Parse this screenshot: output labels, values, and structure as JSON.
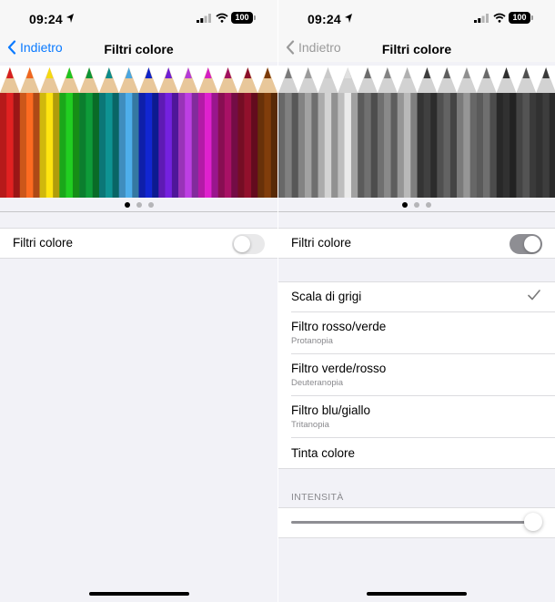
{
  "status": {
    "time": "09:24",
    "battery": "100"
  },
  "nav": {
    "back_label": "Indietro",
    "title": "Filtri colore"
  },
  "banner": {
    "color_pencils": [
      "#d61f1f",
      "#f0661f",
      "#f5d90f",
      "#1fc41f",
      "#0d9436",
      "#0d8c8c",
      "#4aa6e0",
      "#1024c8",
      "#6e1fd4",
      "#b43cd8",
      "#d41fc4",
      "#a01060",
      "#8a0f2a",
      "#7a3a0a"
    ],
    "gray_pencils": [
      "#7a7a7a",
      "#9a9a9a",
      "#c9c9c9",
      "#e0e0e0",
      "#6b6b6b",
      "#828282",
      "#b0b0b0",
      "#3d3d3d",
      "#5e5e5e",
      "#8f8f8f",
      "#6a6a6a",
      "#2f2f2f",
      "#505050",
      "#3a3a3a"
    ]
  },
  "left": {
    "toggle_label": "Filtri colore",
    "toggle_on": false
  },
  "right": {
    "toggle_label": "Filtri colore",
    "toggle_on": true,
    "options": [
      {
        "label": "Scala di grigi",
        "sub": "",
        "selected": true
      },
      {
        "label": "Filtro rosso/verde",
        "sub": "Protanopia",
        "selected": false
      },
      {
        "label": "Filtro verde/rosso",
        "sub": "Deuteranopia",
        "selected": false
      },
      {
        "label": "Filtro blu/giallo",
        "sub": "Tritanopia",
        "selected": false
      },
      {
        "label": "Tinta colore",
        "sub": "",
        "selected": false
      }
    ],
    "intensity_header": "INTENSITÀ",
    "intensity_value": 1.0
  }
}
